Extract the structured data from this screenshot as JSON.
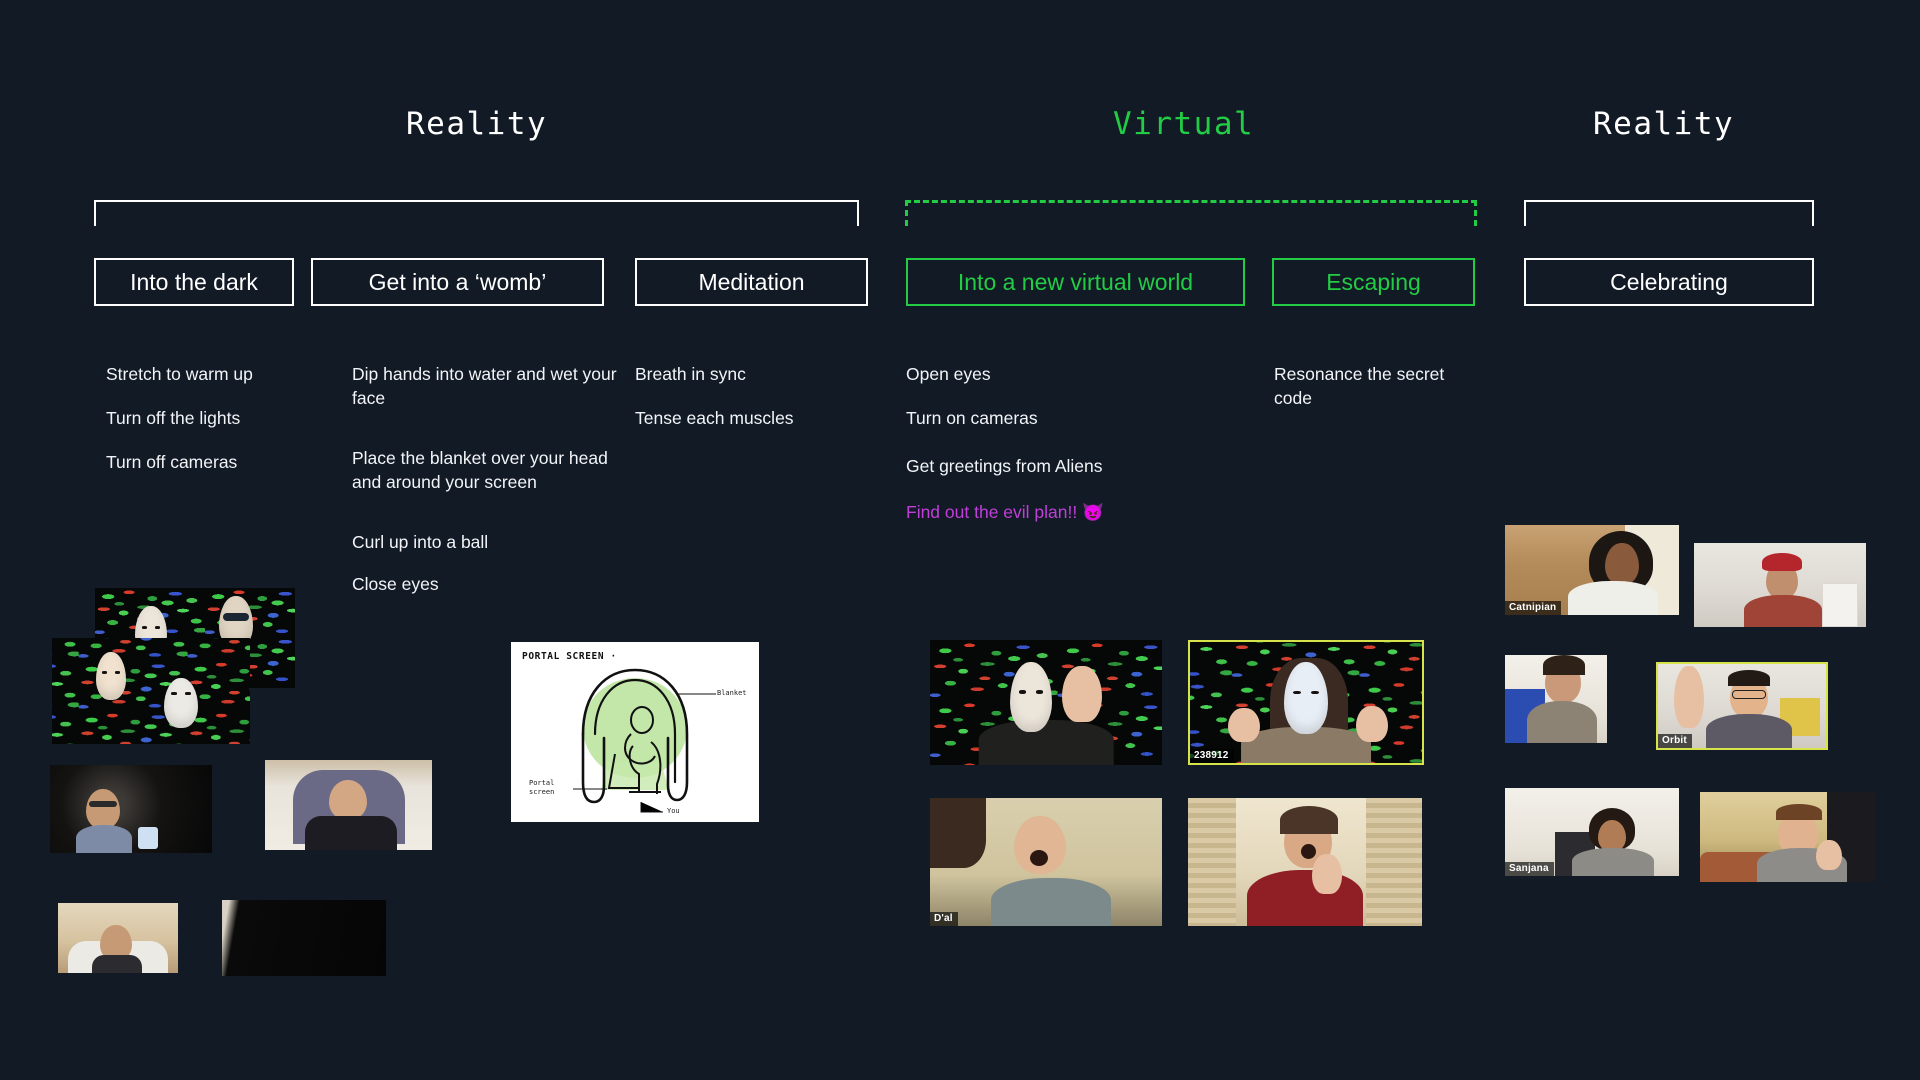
{
  "page": {
    "background_color": "#121a26",
    "text_color": "#f2f4f7",
    "green": "#22cc44",
    "purple": "#bf3fd8"
  },
  "phases": [
    {
      "title": "Reality",
      "color": "#ffffff",
      "bracket": "solid"
    },
    {
      "title": "Virtual",
      "color": "#22cc44",
      "bracket": "dashed"
    },
    {
      "title": "Reality",
      "color": "#ffffff",
      "bracket": "solid"
    }
  ],
  "steps": [
    {
      "label": "Into the dark",
      "color": "#ffffff"
    },
    {
      "label": "Get into a ‘womb’",
      "color": "#ffffff"
    },
    {
      "label": "Meditation",
      "color": "#ffffff"
    },
    {
      "label": "Into a new virtual world",
      "color": "#22cc44"
    },
    {
      "label": "Escaping",
      "color": "#22cc44"
    },
    {
      "label": "Celebrating",
      "color": "#ffffff"
    }
  ],
  "notes": {
    "into_the_dark": [
      "Stretch to warm up",
      "Turn off the lights",
      "Turn off cameras"
    ],
    "womb": [
      "Dip hands into water and wet your face",
      "Place the blanket over your head and around your screen",
      "Curl up into a ball",
      "Close eyes"
    ],
    "meditation": [
      "Breath in sync",
      "Tense each muscles"
    ],
    "new_virtual_world": [
      "Open eyes",
      "Turn on cameras",
      "Get greetings from Aliens",
      "Find out the evil plan!! 😈"
    ],
    "escaping": [
      "Resonance the secret code"
    ]
  },
  "sketch": {
    "title": "PORTAL SCREEN ·",
    "label_blanket": "Blanket",
    "label_portal_screen": "Portal\nscreen",
    "label_you": "You"
  },
  "media": {
    "alien_collage_caption": "",
    "virtual_tiles": [
      {
        "name": "",
        "active": false
      },
      {
        "name": "238912",
        "active": true
      },
      {
        "name": "D'al",
        "active": false
      },
      {
        "name": "",
        "active": false
      }
    ],
    "celebration_tiles": [
      {
        "name": "Catnipian",
        "active": false
      },
      {
        "name": "",
        "active": false
      },
      {
        "name": "",
        "active": false
      },
      {
        "name": "Orbit",
        "active": true
      },
      {
        "name": "Sanjana",
        "active": false
      },
      {
        "name": "",
        "active": false
      }
    ],
    "reality_tiles": [
      {
        "name": "",
        "active": false
      },
      {
        "name": "",
        "active": false
      },
      {
        "name": "",
        "active": false
      },
      {
        "name": "",
        "active": false
      }
    ]
  }
}
